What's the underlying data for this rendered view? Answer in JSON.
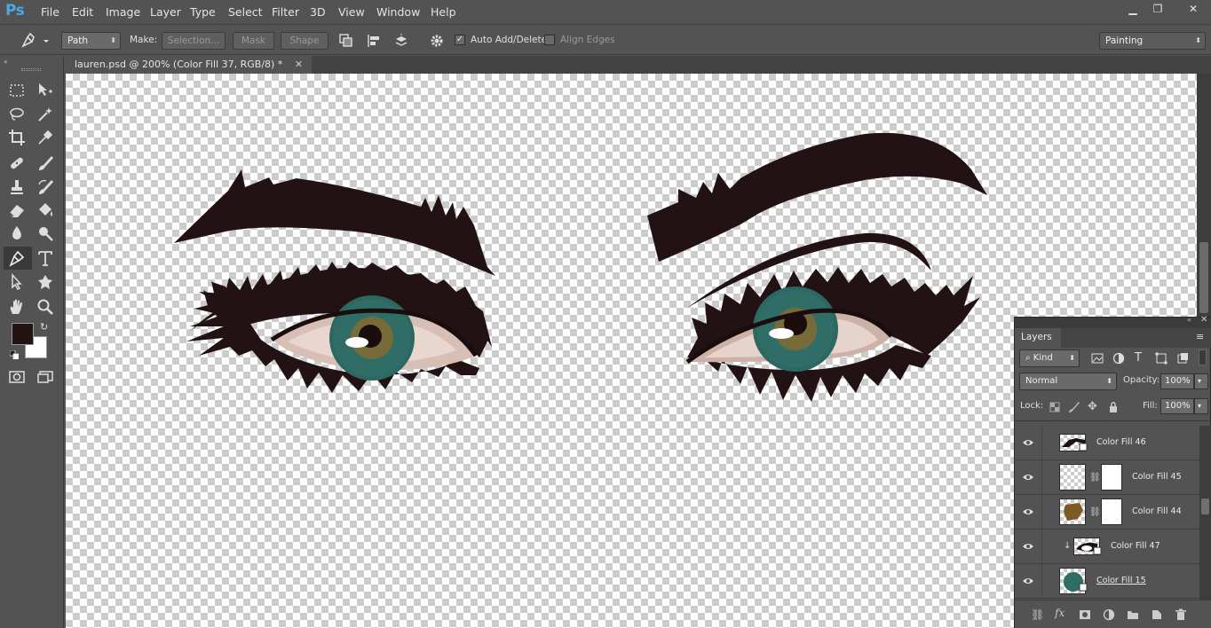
{
  "app": {
    "logo": "Ps"
  },
  "menu": [
    "File",
    "Edit",
    "Image",
    "Layer",
    "Type",
    "Select",
    "Filter",
    "3D",
    "View",
    "Window",
    "Help"
  ],
  "window_controls": {
    "minimize": "▁",
    "restore": "❐",
    "close": "✕"
  },
  "options_bar": {
    "tool_mode": "Path",
    "make_label": "Make:",
    "selection_button": "Selection...",
    "mask_button": "Mask",
    "shape_button": "Shape",
    "auto_add_delete": {
      "label": "Auto Add/Delete",
      "checked": true
    },
    "align_edges": {
      "label": "Align Edges",
      "checked": false
    },
    "workspace": "Painting"
  },
  "document": {
    "tab_title": "lauren.psd @ 200% (Color Fill 37, RGB/8) *",
    "close": "✕"
  },
  "colors": {
    "foreground": "#231313",
    "background": "#ffffff",
    "brow": "#221214",
    "iris": "#2f6d66",
    "iris_center": "#8a6a30"
  },
  "layers_panel": {
    "tab": "Layers",
    "filter_kind": "Kind",
    "blend_mode": "Normal",
    "opacity_label": "Opacity:",
    "opacity_value": "100%",
    "lock_label": "Lock:",
    "fill_label": "Fill:",
    "fill_value": "100%",
    "layers": [
      {
        "name": "Color Fill 46",
        "has_mask": false,
        "clipped": false,
        "thumb": "brow"
      },
      {
        "name": "Color Fill 45",
        "has_mask": true,
        "clipped": false,
        "thumb": "empty"
      },
      {
        "name": "Color Fill 44",
        "has_mask": true,
        "clipped": false,
        "thumb": "brown"
      },
      {
        "name": "Color Fill 47",
        "has_mask": false,
        "clipped": true,
        "thumb": "eye"
      },
      {
        "name": "Color Fill 15",
        "has_mask": false,
        "clipped": false,
        "thumb": "teal"
      }
    ]
  }
}
